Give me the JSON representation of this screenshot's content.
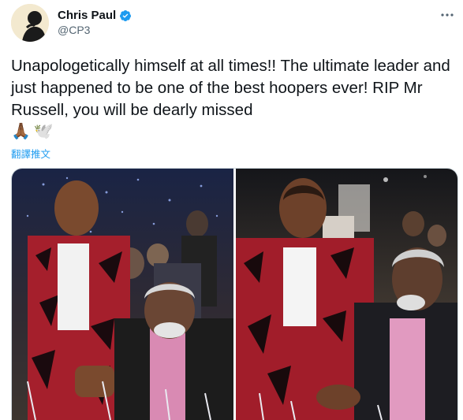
{
  "author": {
    "name": "Chris Paul",
    "handle": "@CP3",
    "verified_icon": "verified-badge-icon",
    "avatar_icon": "avatar-silhouette"
  },
  "tweet": {
    "text": "Unapologetically himself at all times!! The ultimate leader and just happened to be one of the best hoopers ever! RIP Mr Russell, you will be dearly missed",
    "emojis": [
      "🙏🏾",
      "🕊️"
    ],
    "translate_label": "翻譯推文"
  },
  "media": {
    "photos": [
      {
        "id": "photo-1",
        "icon": "photo"
      },
      {
        "id": "photo-2",
        "icon": "photo"
      }
    ]
  },
  "colors": {
    "accent": "#1d9bf0",
    "text": "#0f1419",
    "secondary": "#536471"
  }
}
